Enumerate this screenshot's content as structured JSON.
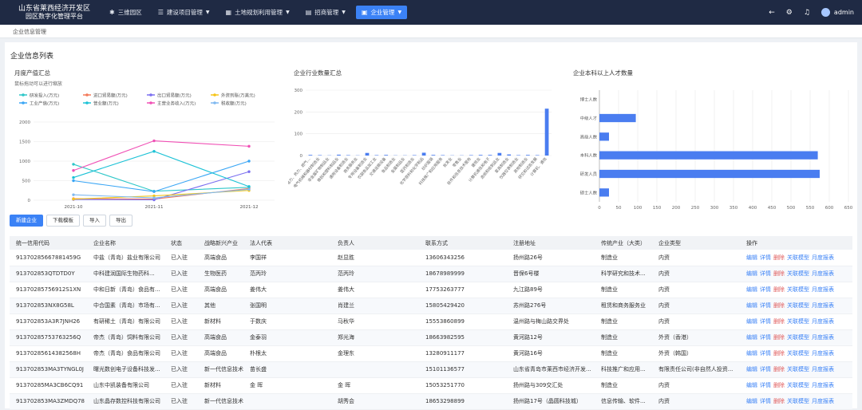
{
  "brand": {
    "line1": "山东省莱西经济开发区",
    "line2": "园区数字化管理平台"
  },
  "nav": [
    {
      "label": "三维园区",
      "icon": "✱",
      "chevron": false,
      "active": false
    },
    {
      "label": "建设项目管理",
      "icon": "☰",
      "chevron": true,
      "active": false
    },
    {
      "label": "土地规划利用管理",
      "icon": "▦",
      "chevron": true,
      "active": false
    },
    {
      "label": "招商管理",
      "icon": "▤",
      "chevron": true,
      "active": false
    },
    {
      "label": "企业管理",
      "icon": "▣",
      "chevron": true,
      "active": true
    }
  ],
  "user": {
    "name": "admin"
  },
  "breadcrumb": "企业信息管理",
  "panel_title": "企业信息列表",
  "chart1": {
    "title": "月度产值汇总",
    "subtitle": "鼠标拖动可以进行缩放",
    "legend": [
      {
        "name": "研发投入(万元)",
        "color": "#2ec7c9"
      },
      {
        "name": "进口贸易额(万元)",
        "color": "#f47a5a"
      },
      {
        "name": "出口贸易额(万元)",
        "color": "#7b6ff0"
      },
      {
        "name": "外资到账(万美元)",
        "color": "#f5c518"
      },
      {
        "name": "工业产值(万元)",
        "color": "#3aa6f5"
      },
      {
        "name": "营业额(万元)",
        "color": "#1cc2d6"
      },
      {
        "name": "主营业务收入(万元)",
        "color": "#f050b5"
      },
      {
        "name": "税收额(万元)",
        "color": "#7fb9f0"
      }
    ]
  },
  "chart2": {
    "title": "企业行业数量汇总"
  },
  "chart3": {
    "title": "企业本科以上人才数量"
  },
  "chart_data": [
    {
      "type": "line",
      "title": "月度产值汇总",
      "x": [
        "2021-10",
        "2021-11",
        "2021-12"
      ],
      "ylim": [
        0,
        2000
      ],
      "yticks": [
        0,
        500,
        1000,
        1500,
        2000
      ],
      "series": [
        {
          "name": "研发投入(万元)",
          "color": "#2ec7c9",
          "values": [
            920,
            230,
            330
          ]
        },
        {
          "name": "进口贸易额(万元)",
          "color": "#f47a5a",
          "values": [
            40,
            30,
            300
          ]
        },
        {
          "name": "出口贸易额(万元)",
          "color": "#7b6ff0",
          "values": [
            20,
            10,
            730
          ]
        },
        {
          "name": "外资到账(万美元)",
          "color": "#f5c518",
          "values": [
            30,
            110,
            250
          ]
        },
        {
          "name": "工业产值(万元)",
          "color": "#3aa6f5",
          "values": [
            500,
            220,
            1000
          ]
        },
        {
          "name": "营业额(万元)",
          "color": "#1cc2d6",
          "values": [
            580,
            1250,
            350
          ]
        },
        {
          "name": "主营业务收入(万元)",
          "color": "#f050b5",
          "values": [
            760,
            1520,
            1380
          ]
        },
        {
          "name": "税收额(万元)",
          "color": "#7fb9f0",
          "values": [
            140,
            60,
            280
          ]
        }
      ],
      "grid": true
    },
    {
      "type": "bar",
      "title": "企业行业数量汇总",
      "ylim": [
        0,
        300
      ],
      "yticks": [
        0,
        100,
        200,
        300
      ],
      "categories": [
        "电力、热力、燃气…",
        "电气机械和器材制造业",
        "非金属矿物制品业",
        "橡胶和塑料制品业",
        "通用设备制造业",
        "商务服务业",
        "专用设备制造业",
        "农副食品加工业",
        "交通运输设备",
        "食品制造业",
        "金属制品业",
        "医药制造业",
        "化学原料和化学制品",
        "纺织服装",
        "科技推广和应用服务",
        "批发业",
        "零售业",
        "软件和信息技术服务",
        "建筑业",
        "计算机通信和电子",
        "造纸和纸制品业",
        "家具制造业",
        "仪器仪表制造业",
        "其他制造业",
        "研究和试验发展",
        "计算机、通信"
      ],
      "values": [
        3,
        2,
        1,
        4,
        2,
        1,
        12,
        2,
        3,
        1,
        1,
        2,
        13,
        3,
        2,
        1,
        1,
        2,
        3,
        3,
        12,
        5,
        2,
        3,
        2,
        215
      ],
      "color": "#4a7df0"
    },
    {
      "type": "bar",
      "orientation": "horizontal",
      "title": "企业本科以上人才数量",
      "categories": [
        "博士人数",
        "中级人才",
        "高级人数",
        "本科人数",
        "研发人员",
        "硕士人数"
      ],
      "values": [
        0,
        95,
        25,
        570,
        575,
        25
      ],
      "xlim": [
        0,
        650
      ],
      "xticks": [
        0,
        50,
        100,
        150,
        200,
        250,
        300,
        350,
        400,
        450,
        500,
        550,
        600,
        650
      ],
      "color": "#4a7df0"
    }
  ],
  "buttons": {
    "add": "新建企业",
    "download": "下载模板",
    "import": "导入",
    "export": "导出"
  },
  "table": {
    "headers": [
      "统一信用代码",
      "企业名称",
      "状态",
      "战略新兴产业",
      "法人代表",
      "负责人",
      "联系方式",
      "注册地址",
      "传统产业（大类）",
      "企业类型",
      "操作"
    ],
    "ops": [
      "编辑",
      "详情",
      "删除",
      "关联模型",
      "月度报表"
    ],
    "rows": [
      [
        "91370285667881459G",
        "中盐（青岛）盐业有限公司",
        "已入驻",
        "高端食品",
        "李国祥",
        "赵显胜",
        "13606343256",
        "扬州路26号",
        "制造业",
        "内资"
      ],
      [
        "913702853QTDTD0Y",
        "中科建润国际生物药科...",
        "已入驻",
        "生物医药",
        "范丙玲",
        "范丙玲",
        "18678989999",
        "晋保6号楼",
        "科学研究和技术...",
        "内资"
      ],
      [
        "91370285756912S1XN",
        "中和日新（青岛）食品有...",
        "已入驻",
        "高端食品",
        "姜伟大",
        "姜伟大",
        "17753263777",
        "九江路89号",
        "制造业",
        "内资"
      ],
      [
        "913702853NX8G58L",
        "中合国素（青岛）市场有...",
        "已入驻",
        "其他",
        "张国明",
        "肖建兰",
        "15805429420",
        "苏州路276号",
        "租赁和商务服务业",
        "内资"
      ],
      [
        "913702853A3R7JNH26",
        "有研稀土（青岛）有限公司",
        "已入驻",
        "新材料",
        "于数庆",
        "马秋华",
        "15553860899",
        "温州路与梅山路交界处",
        "制造业",
        "内资"
      ],
      [
        "91370285753763256Q",
        "帝杰（青岛）饲料有限公司",
        "已入驻",
        "高端食品",
        "金泰羽",
        "郑光海",
        "18663982595",
        "黄河路12号",
        "制造业",
        "外资（香港）"
      ],
      [
        "91370285614382568H",
        "帝杰（青岛）食品有限公司",
        "已入驻",
        "高端食品",
        "朴根太",
        "金理东",
        "13280911177",
        "黄河路16号",
        "制造业",
        "外资（韩国）"
      ],
      [
        "913702853MA3TYNGL0J",
        "曙光数创电子设备科技发...",
        "已入驻",
        "新一代信息技术",
        "苗长盛",
        "",
        "15101136577",
        "山东省青岛市莱西市经济开发...",
        "科技推广和应用...",
        "有限责任公司(非自然人投资..."
      ],
      [
        "91370285MA3CB6CQ91",
        "山东中凯装备有限公司",
        "已入驻",
        "新材料",
        "金 晖",
        "金 晖",
        "15053251770",
        "扬州路与309交汇处",
        "制造业",
        "内资"
      ],
      [
        "913702853MA3ZMDQ78",
        "山东晶存数控科技有限公司",
        "已入驻",
        "新一代信息技术",
        "",
        "胡秀会",
        "18653298899",
        "扬州路17号（晶圆科技城）",
        "信息传输、软件...",
        "内资"
      ]
    ]
  }
}
